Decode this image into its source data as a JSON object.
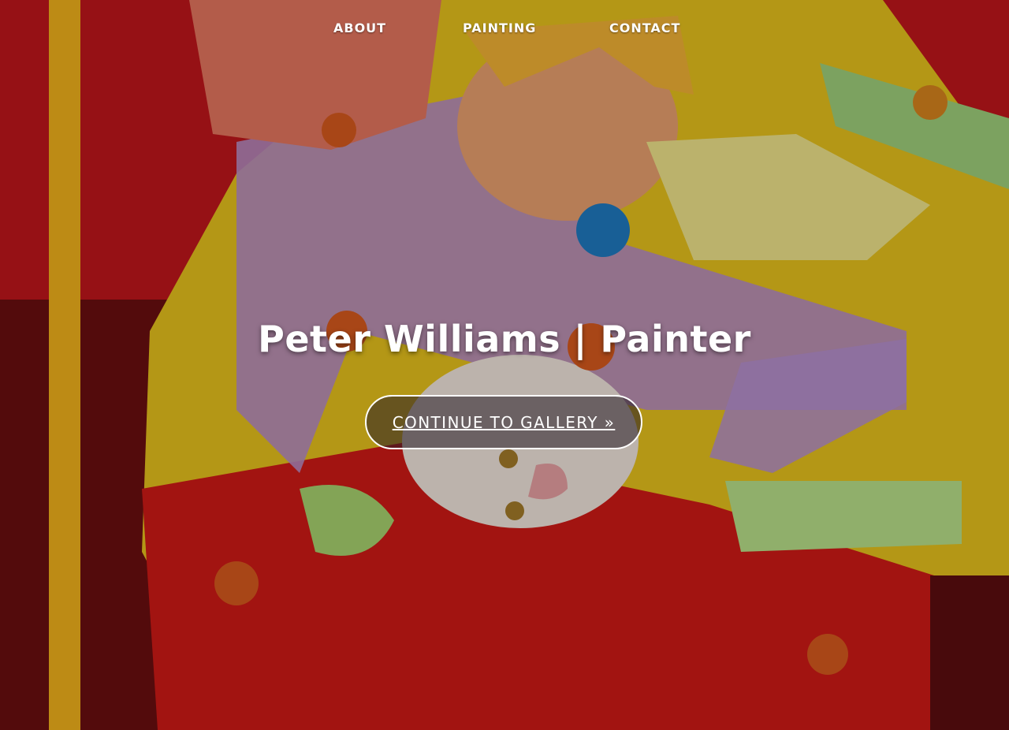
{
  "nav": {
    "items": [
      {
        "label": "ABOUT"
      },
      {
        "label": "PAINTING"
      },
      {
        "label": "CONTACT"
      }
    ]
  },
  "hero": {
    "title": "Peter Williams | Painter",
    "cta_label": "CONTINUE TO GALLERY »"
  },
  "colors": {
    "background_red": "#c0171b",
    "overlay": "rgba(0,0,0,0.22)",
    "text": "#ffffff"
  }
}
